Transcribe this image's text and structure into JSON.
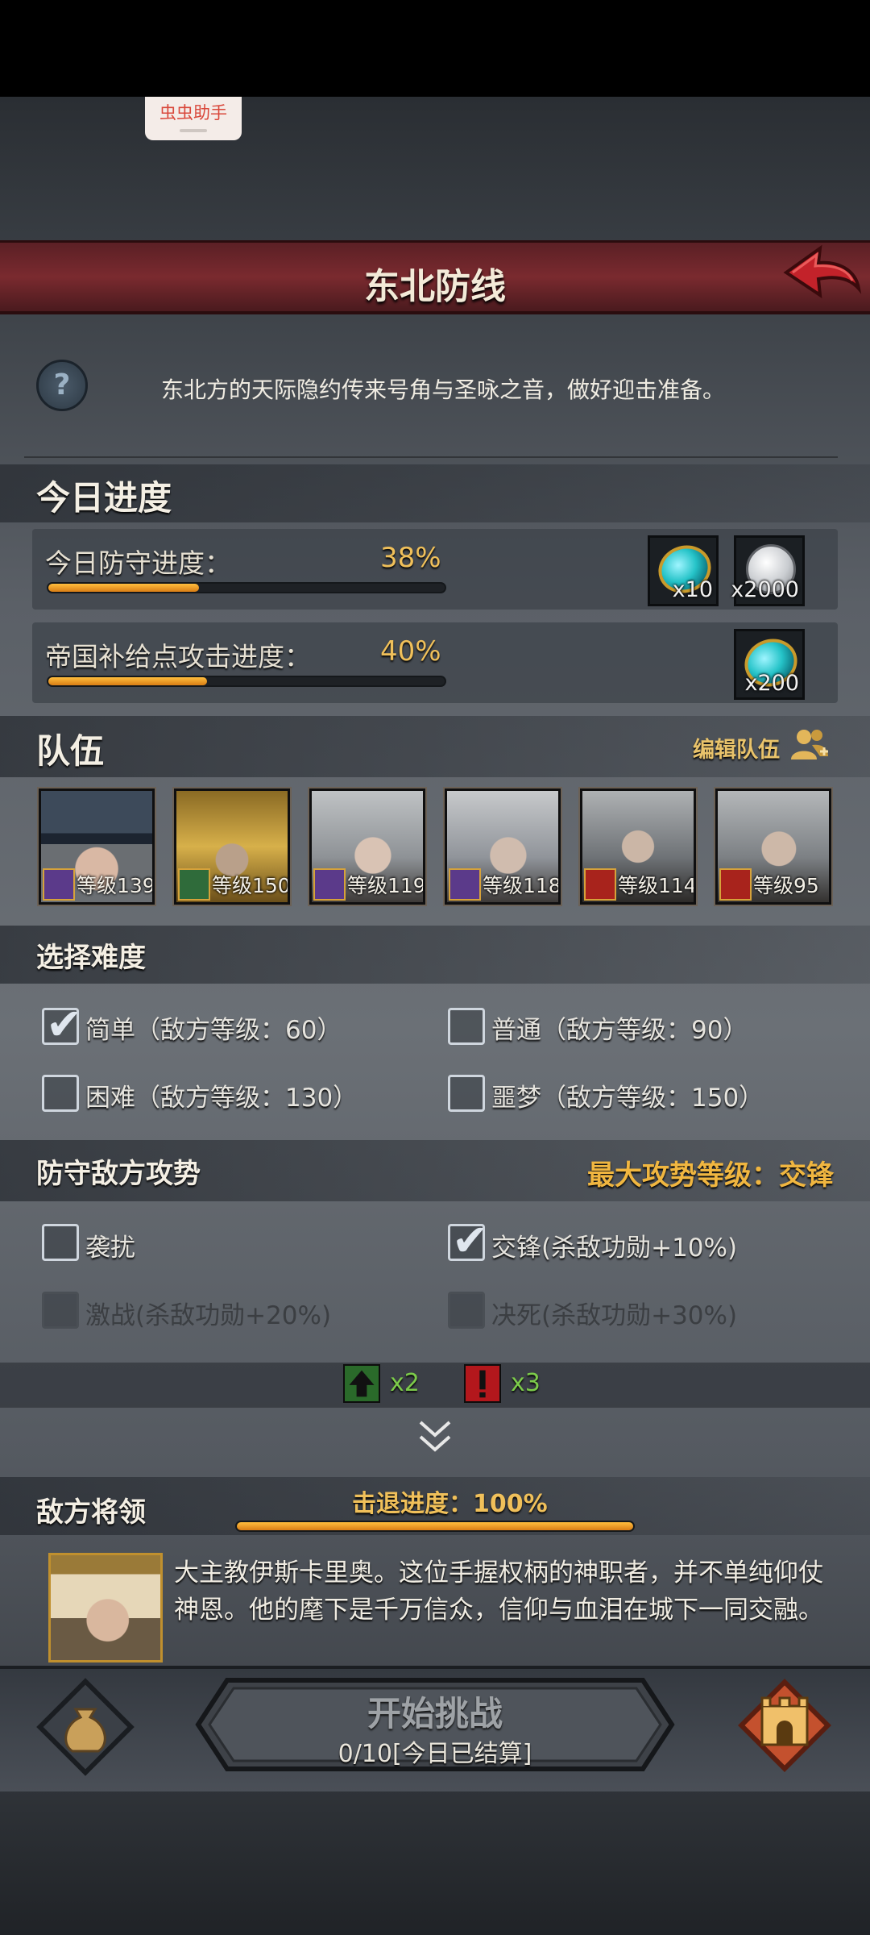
{
  "assistant": {
    "label": "虫虫助手"
  },
  "header": {
    "title": "东北防线"
  },
  "intro": {
    "text": "东北方的天际隐约传来号角与圣咏之音，做好迎击准备。"
  },
  "today": {
    "title": "今日进度",
    "defense": {
      "label": "今日防守进度：",
      "percent_text": "38%",
      "progress": 0.38,
      "rewards": [
        {
          "icon": "turquoise-gem-icon",
          "count": "x10"
        },
        {
          "icon": "silver-coin-icon",
          "count": "x2000"
        }
      ]
    },
    "supply": {
      "label": "帝国补给点攻击进度：",
      "percent_text": "40%",
      "progress": 0.4,
      "rewards": [
        {
          "icon": "turquoise-gem-icon",
          "count": "x200"
        }
      ]
    }
  },
  "team": {
    "title": "队伍",
    "edit_label": "编辑队伍",
    "heroes": [
      {
        "level": "等级139",
        "class_icon": "staff-icon"
      },
      {
        "level": "等级150",
        "class_icon": "bow-icon"
      },
      {
        "level": "等级119",
        "class_icon": "staff-icon"
      },
      {
        "level": "等级118",
        "class_icon": "staff-icon"
      },
      {
        "level": "等级114",
        "class_icon": "horse-icon"
      },
      {
        "level": "等级95",
        "class_icon": "horse-icon"
      }
    ]
  },
  "difficulty": {
    "title": "选择难度",
    "options": [
      {
        "label": "简单（敌方等级：60）",
        "checked": true
      },
      {
        "label": "普通（敌方等级：90）",
        "checked": false
      },
      {
        "label": "困难（敌方等级：130）",
        "checked": false
      },
      {
        "label": "噩梦（敌方等级：150）",
        "checked": false
      }
    ]
  },
  "offense": {
    "title": "防守敌方攻势",
    "max_label": "最大攻势等级：交锋",
    "options": [
      {
        "label": "袭扰",
        "checked": false,
        "enabled": true
      },
      {
        "label": "交锋(杀敌功勋+10%)",
        "checked": true,
        "enabled": true
      },
      {
        "label": "激战(杀敌功勋+20%)",
        "checked": false,
        "enabled": false
      },
      {
        "label": "决死(杀敌功勋+30%)",
        "checked": false,
        "enabled": false
      }
    ],
    "counters": [
      {
        "icon": "green-up-arrow-icon",
        "text": "x2"
      },
      {
        "icon": "red-exclamation-icon",
        "text": "x3"
      }
    ]
  },
  "enemy": {
    "title": "敌方将领",
    "repel_label": "击退进度：100%",
    "repel_progress": 1.0,
    "description": "大主教伊斯卡里奥。这位手握权柄的神职者，并不单纯仰仗神恩。他的麾下是千万信众，信仰与血泪在城下一同交融。"
  },
  "bottom": {
    "start_title": "开始挑战",
    "start_sub": "0/10[今日已结算]"
  },
  "colors": {
    "accent": "#f0b640",
    "header_red": "#7a2a2f",
    "progress_orange": "#e9961f"
  }
}
